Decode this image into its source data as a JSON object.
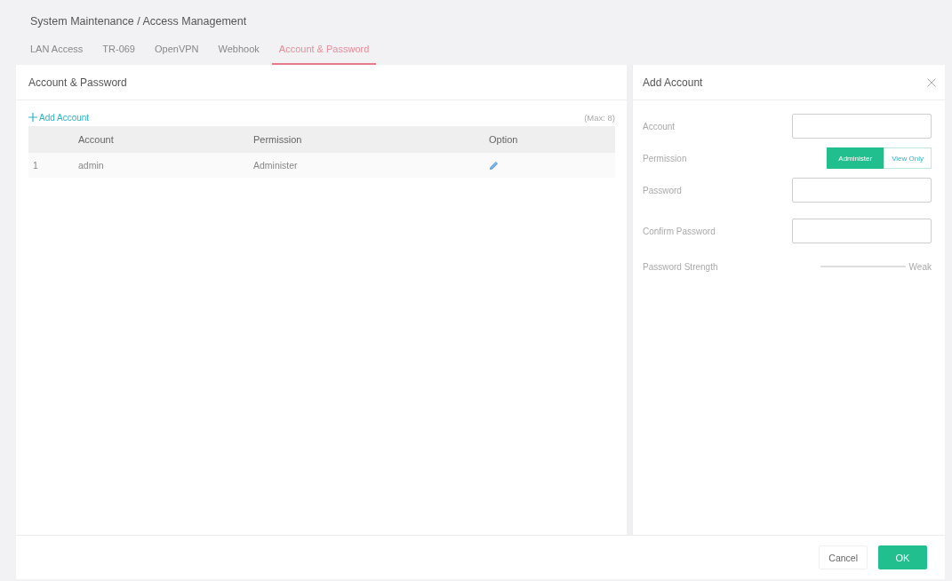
{
  "title": "System Maintenance / Access Management",
  "tabs": [
    {
      "label": "LAN Access",
      "selected": false
    },
    {
      "label": "TR-069",
      "selected": false
    },
    {
      "label": "OpenVPN",
      "selected": false
    },
    {
      "label": "Webhook",
      "selected": false
    },
    {
      "label": "Account & Password",
      "selected": true
    }
  ],
  "list_panel": {
    "title": "Account & Password",
    "add_link": "Add Account",
    "max_note": "(Max: 8)",
    "columns": [
      "Account",
      "Permission",
      "Option"
    ],
    "rows": [
      {
        "index": "1",
        "account": "admin",
        "permission": "Administer"
      }
    ]
  },
  "form": {
    "title": "Add Account",
    "fields": [
      {
        "kind": "input",
        "label": "Account"
      },
      {
        "kind": "toggle",
        "label": "Permission",
        "options": [
          {
            "label": "Administer",
            "selected": true
          },
          {
            "label": "View Only",
            "selected": false
          }
        ]
      },
      {
        "kind": "password",
        "label": "Password"
      },
      {
        "kind": "password",
        "label": "Confirm Password"
      },
      {
        "kind": "strength",
        "label": "Password Strength",
        "reading": "Weak"
      }
    ]
  },
  "buttons": [
    {
      "label": "Cancel",
      "kind": "secondary"
    },
    {
      "label": "OK",
      "kind": "primary"
    }
  ]
}
